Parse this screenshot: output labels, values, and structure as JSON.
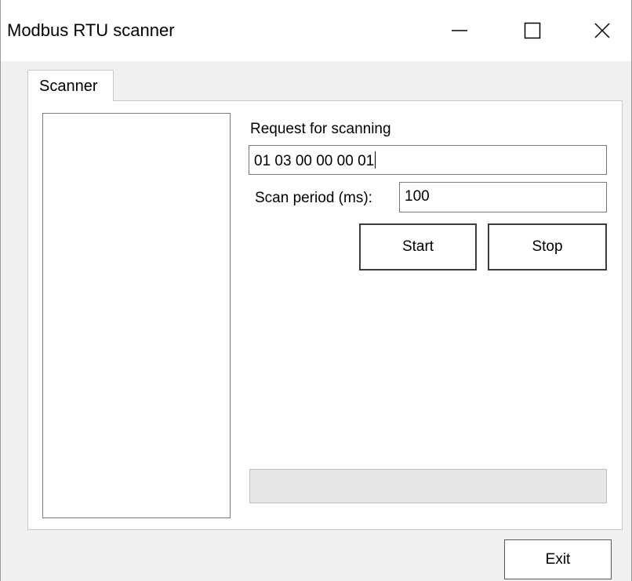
{
  "window": {
    "title": "Modbus RTU scanner",
    "controls": {
      "minimize_icon": "minimize-icon",
      "maximize_icon": "maximize-icon",
      "close_icon": "close-icon"
    }
  },
  "tabs": [
    {
      "label": "Scanner",
      "selected": true
    }
  ],
  "scanner": {
    "request_label": "Request for scanning",
    "request_value": "01 03 00 00 00 01",
    "period_label": "Scan period (ms):",
    "period_value": "100",
    "start_label": "Start",
    "stop_label": "Stop",
    "progress": 0
  },
  "footer": {
    "exit_label": "Exit"
  },
  "colors": {
    "window_bg": "#f0f0f0",
    "titlebar_bg": "#ffffff",
    "panel_bg": "#ffffff",
    "progress_track": "#e6e6e6",
    "progress_fill": "#06b025"
  }
}
